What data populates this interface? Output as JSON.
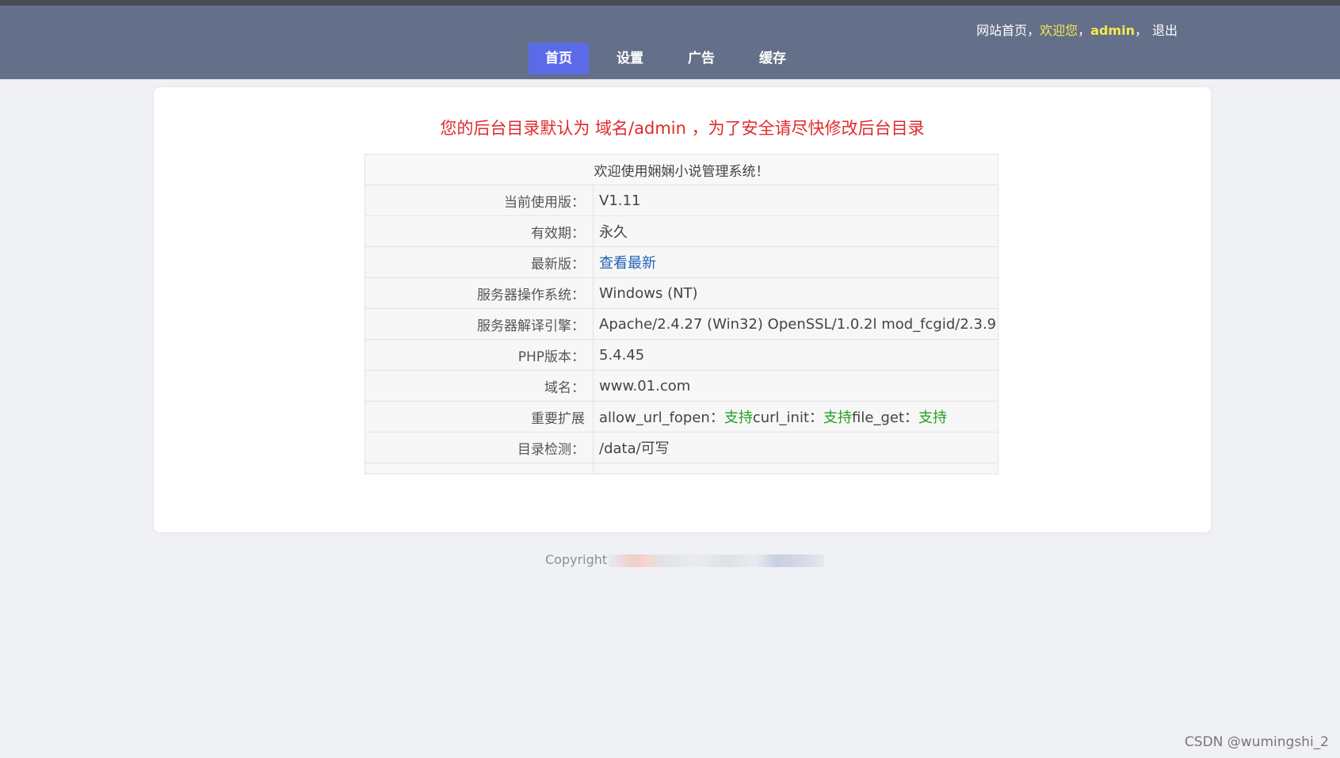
{
  "header": {
    "site_home": "网站首页",
    "sep1": "，",
    "welcome": "欢迎您",
    "sep2": "，",
    "username": "admin",
    "sep3": "，",
    "logout": "退出",
    "nav": [
      {
        "label": "首页",
        "active": true
      },
      {
        "label": "设置",
        "active": false
      },
      {
        "label": "广告",
        "active": false
      },
      {
        "label": "缓存",
        "active": false
      }
    ]
  },
  "main": {
    "warning": "您的后台目录默认为 域名/admin ，为了安全请尽快修改后台目录",
    "table_title": "欢迎使用娴娴小说管理系统！",
    "rows": {
      "version": {
        "label": "当前使用版：",
        "value": "V1.11"
      },
      "validity": {
        "label": "有效期：",
        "value": "永久"
      },
      "latest": {
        "label": "最新版：",
        "value": "查看最新"
      },
      "os": {
        "label": "服务器操作系统：",
        "value": "Windows (NT)"
      },
      "engine": {
        "label": "服务器解译引擎：",
        "value": "Apache/2.4.27 (Win32) OpenSSL/1.0.2l mod_fcgid/2.3.9"
      },
      "php": {
        "label": "PHP版本：",
        "value": "5.4.45"
      },
      "domain": {
        "label": "域名：",
        "value": "www.01.com"
      },
      "extensions": {
        "label": "重要扩展",
        "allow_url_fopen": "allow_url_fopen：",
        "allow_url_fopen_status": "支持",
        "curl_init": "curl_init：",
        "curl_init_status": "支持",
        "file_get": "file_get：",
        "file_get_status": "支持"
      },
      "dir_check": {
        "label": "目录检测：",
        "value": "/data/可写"
      }
    }
  },
  "footer": {
    "copyright": "Copyright"
  },
  "watermark": "CSDN @wumingshi_2",
  "colors": {
    "header_bg": "#646f8a",
    "nav_active": "#5b6be8",
    "warning_red": "#e02a2a",
    "link_blue": "#2262b5",
    "status_green": "#22a022",
    "welcome_yellow": "#f6e94b"
  }
}
